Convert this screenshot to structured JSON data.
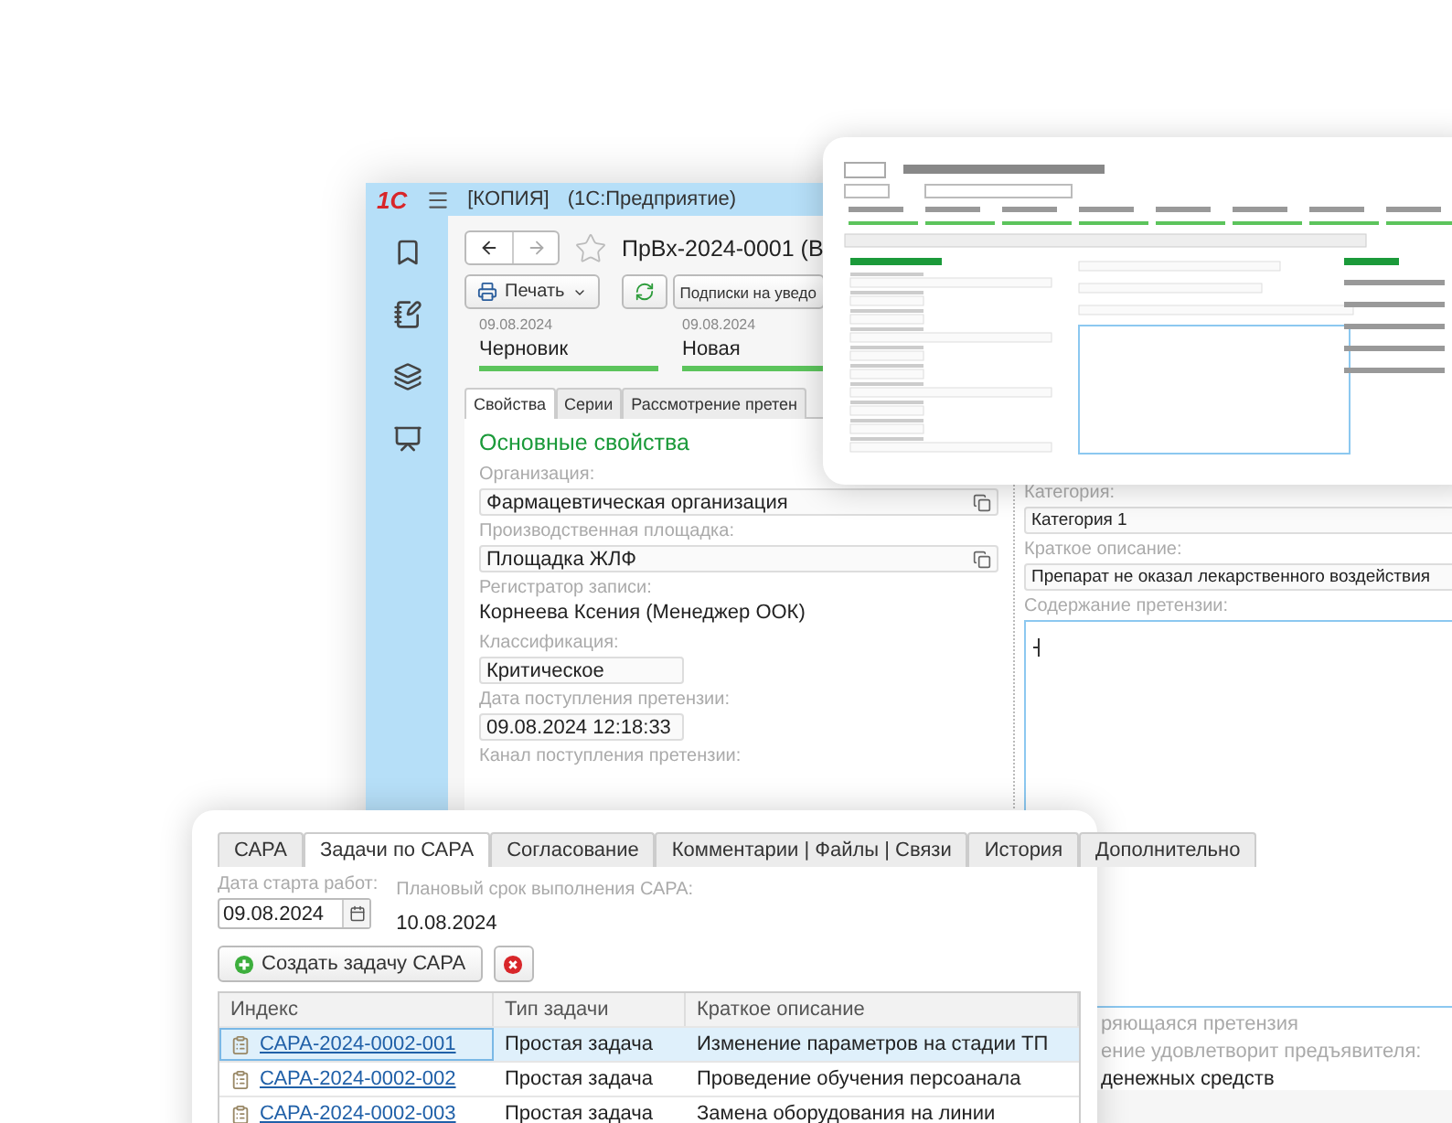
{
  "main_window": {
    "logo": "1С",
    "title": "[КОПИЯ]",
    "app": "(1С:Предприятие)",
    "document_title": "ПрВх-2024-0001 (В",
    "favorite": false,
    "print_button": "Печать",
    "subscriptions_button": "Подписки на уведо",
    "stages": [
      {
        "date": "09.08.2024",
        "name": "Черновик",
        "done": true
      },
      {
        "date": "09.08.2024",
        "name": "Новая",
        "done": true
      }
    ],
    "tabs": [
      {
        "label": "Свойства",
        "selected": true
      },
      {
        "label": "Серии",
        "selected": false
      },
      {
        "label": "Рассмотрение претен",
        "selected": false
      }
    ],
    "section": "Основные свойства",
    "fields": [
      {
        "kind": "select",
        "label": "Организация:",
        "value": "Фармацевтическая организация"
      },
      {
        "kind": "select",
        "label": "Производственная площадка:",
        "value": "Площадка ЖЛФ"
      },
      {
        "kind": "text",
        "label": "Регистратор записи:",
        "value": "Корнеева Ксения (Менеджер ООК)"
      },
      {
        "kind": "input",
        "label": "Классификация:",
        "value": "Критическое"
      },
      {
        "kind": "input",
        "label": "Дата поступления претензии:",
        "value": "09.08.2024 12:18:33"
      },
      {
        "kind": "label",
        "label": "Канал поступления претензии:"
      }
    ],
    "right_fields": [
      {
        "kind": "input",
        "label": "Категория:",
        "value": "Категория 1"
      },
      {
        "kind": "input",
        "label": "Краткое описание:",
        "value": "Препарат не оказал лекарственного воздействия"
      },
      {
        "kind": "textarea",
        "label": "Содержание претензии:"
      }
    ],
    "partial_texts": [
      {
        "kind": "label",
        "text": "ряющаяся претензия"
      },
      {
        "kind": "label",
        "text": "ение удовлетворит предъявителя:"
      },
      {
        "kind": "value",
        "text": "денежных средств"
      }
    ]
  },
  "capa_window": {
    "tabs": [
      {
        "label": "САРА",
        "selected": false
      },
      {
        "label": "Задачи по САРА",
        "selected": true
      },
      {
        "label": "Согласование",
        "selected": false
      },
      {
        "label": "Комментарии | Файлы | Связи",
        "selected": false
      },
      {
        "label": "История",
        "selected": false
      },
      {
        "label": "Дополнительно",
        "selected": false
      }
    ],
    "start_label": "Дата старта работ:",
    "start_date": "09.08.2024",
    "plan_label": "Плановый срок выполнения САРА:",
    "plan_date": "10.08.2024",
    "create_button": "Создать задачу САРА",
    "columns": [
      "Индекс",
      "Тип задачи",
      "Краткое описание"
    ],
    "rows": [
      {
        "index": "САРА-2024-0002-001",
        "type": "Простая задача",
        "description": "Изменение параметров на стадии ТП",
        "selected": true
      },
      {
        "index": "САРА-2024-0002-002",
        "type": "Простая задача",
        "description": "Проведение обучения персоанала",
        "selected": false
      },
      {
        "index": "САРА-2024-0002-003",
        "type": "Простая задача",
        "description": "Замена оборудования на линии",
        "selected": false
      }
    ]
  }
}
